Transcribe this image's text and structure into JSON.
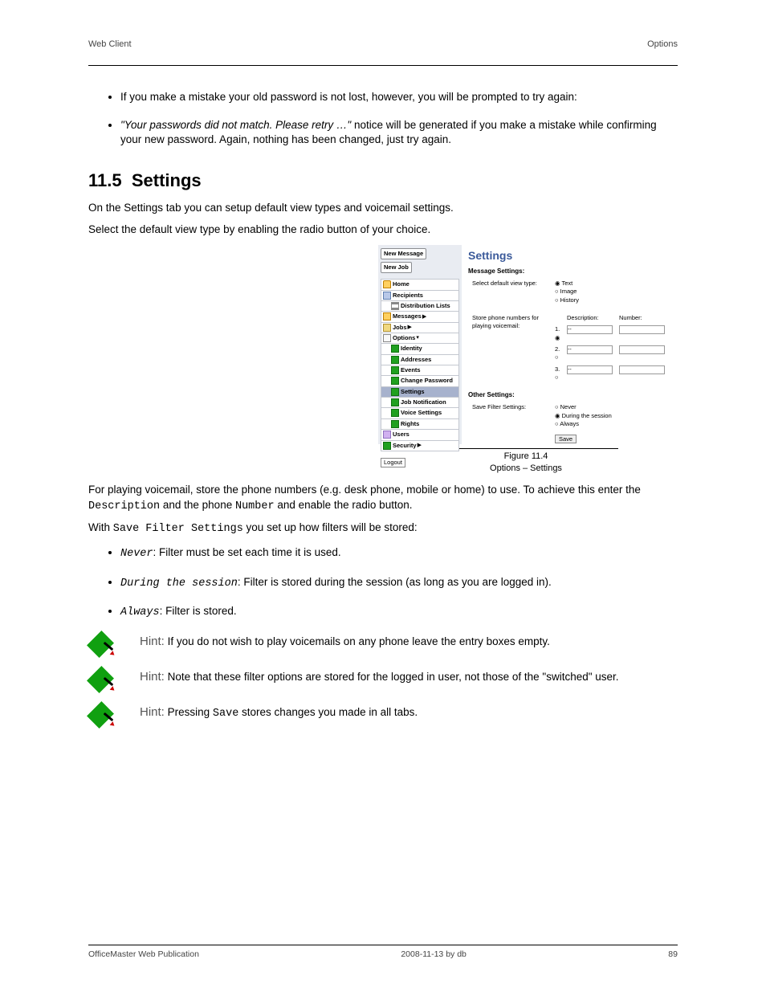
{
  "header": {
    "left": "Web Client",
    "right": "Options"
  },
  "bullets_top": {
    "b1": "If you make a mistake your old password is not lost, however, you will be prompted to try again:",
    "b2_prefix": "\"Your passwords did not match. Please retry …\"",
    "b2_rest": " notice will be generated if you make a mistake while confirming your new password. Again, nothing has been changed, just try again."
  },
  "section": {
    "num": "11.5",
    "title": "Settings",
    "intro1": "On the Settings tab you can setup default view types and voicemail settings.",
    "intro2": "Select the default view type by enabling the radio button of your choice."
  },
  "figure": {
    "side": {
      "new_message": "New Message",
      "new_job": "New Job",
      "items": {
        "home": "Home",
        "recipients": "Recipients",
        "dlists": "Distribution Lists",
        "messages": "Messages",
        "jobs": "Jobs",
        "options": "Options",
        "identity": "Identity",
        "addresses": "Addresses",
        "events": "Events",
        "chpw": "Change Password",
        "settings": "Settings",
        "jobnotif": "Job Notification",
        "voice": "Voice Settings",
        "rights": "Rights",
        "users": "Users",
        "security": "Security"
      },
      "logout": "Logout"
    },
    "main": {
      "title": "Settings",
      "group1": "Message Settings:",
      "label_viewtype": "Select default view type:",
      "opt_text": "Text",
      "opt_image": "Image",
      "opt_history": "History",
      "label_store": "Store phone numbers for playing voicemail:",
      "col_desc": "Description:",
      "col_num": "Number:",
      "rows": [
        "1.",
        "2.",
        "3."
      ],
      "group2": "Other Settings:",
      "label_filter": "Save Filter Settings:",
      "opt_never": "Never",
      "opt_session": "During the session",
      "opt_always": "Always",
      "save": "Save"
    },
    "cap_top": "Figure 11.4",
    "cap_bottom": "Options – Settings"
  },
  "body": {
    "voicemail_intro_1": "For playing voicemail, store the phone numbers (e.g. desk phone, mobile or home) to use. To achieve this enter the ",
    "voicemail_intro_desc": "Description",
    "voicemail_intro_2": " and the phone ",
    "voicemail_intro_num": "Number",
    "voicemail_intro_3": " and enable the radio button.",
    "filters_intro_1": "With ",
    "filters_intro_term": "Save Filter Settings",
    "filters_intro_2": " you set up how filters will be stored:",
    "opt_never_label": "Never",
    "opt_never_text": ": Filter must be set each time it is used.",
    "opt_session_label": "During the session",
    "opt_session_text": ": Filter is stored during the session (as long as you are logged in).",
    "opt_always_label": "Always",
    "opt_always_text": ": Filter is stored."
  },
  "hints": {
    "label": "Hint:",
    "h1": "If you do not wish to play voicemails on any phone leave the entry boxes empty.",
    "h2_a": "Note that these filter options are stored for the logged in user, not those of the \"switched\" user.",
    "h2_b": "",
    "h3_1": "Pressing ",
    "h3_save": "Save",
    "h3_2": " stores changes you made in all tabs."
  },
  "footer": {
    "pub": "OfficeMaster Web Publication",
    "date": "2008-11-13 by db",
    "page": "89"
  }
}
